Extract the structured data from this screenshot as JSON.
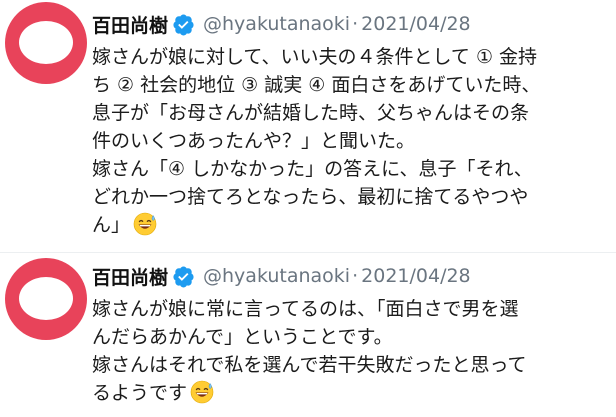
{
  "tweets": [
    {
      "author_name": "百田尚樹",
      "verified_icon": "verified-badge-icon",
      "handle": "@hyakutanaoki",
      "separator": "·",
      "date": "2021/04/28",
      "lines": [
        "嫁さんが娘に対して、いい夫の４条件として ① 金持",
        "ち ② 社会的地位 ③ 誠実 ④ 面白さをあげていた時、",
        "息子が「お母さんが結婚した時、父ちゃんはその条",
        "件のいくつあったんや？」と聞いた。",
        "嫁さん「④ しかなかった」の答えに、息子「それ、",
        "どれか一つ捨てろとなったら、最初に捨てるやつや",
        "ん」"
      ],
      "emoji": "grinning-sweat-emoji"
    },
    {
      "author_name": "百田尚樹",
      "verified_icon": "verified-badge-icon",
      "handle": "@hyakutanaoki",
      "separator": "·",
      "date": "2021/04/28",
      "lines": [
        "嫁さんが娘に常に言ってるのは、「面白さで男を選",
        "んだらあかんで」ということです。",
        "嫁さんはそれで私を選んで若干失敗だったと思って",
        "るようです"
      ],
      "emoji": "grinning-sweat-emoji"
    }
  ],
  "colors": {
    "avatar": "#e8435a",
    "verified": "#1d9bf0",
    "meta": "#6a7580",
    "text": "#1b1b1b"
  }
}
